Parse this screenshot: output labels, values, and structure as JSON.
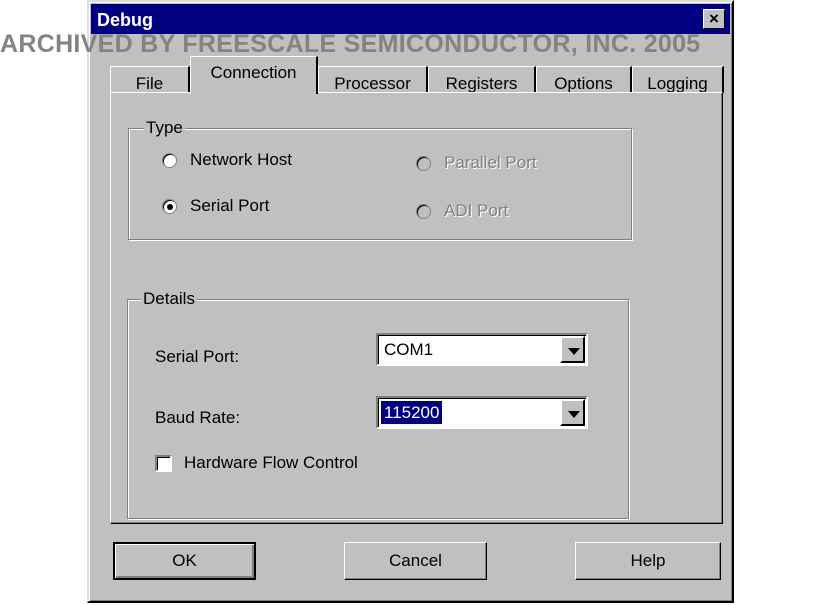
{
  "watermark": "ARCHIVED BY FREESCALE SEMICONDUCTOR, INC. 2005",
  "window": {
    "title": "Debug",
    "close_glyph": "×"
  },
  "tabs": [
    {
      "label": "File",
      "active": false
    },
    {
      "label": "Connection",
      "active": true
    },
    {
      "label": "Processor",
      "active": false
    },
    {
      "label": "Registers",
      "active": false
    },
    {
      "label": "Options",
      "active": false
    },
    {
      "label": "Logging",
      "active": false
    }
  ],
  "type_group": {
    "legend": "Type",
    "options": [
      {
        "label": "Network Host",
        "checked": false,
        "enabled": true
      },
      {
        "label": "Parallel Port",
        "checked": false,
        "enabled": false
      },
      {
        "label": "Serial Port",
        "checked": true,
        "enabled": true
      },
      {
        "label": "ADI Port",
        "checked": false,
        "enabled": false
      }
    ]
  },
  "details_group": {
    "legend": "Details",
    "serial_port_label": "Serial Port:",
    "serial_port_value": "COM1",
    "baud_rate_label": "Baud Rate:",
    "baud_rate_value": "115200",
    "flow_control_label": "Hardware Flow Control",
    "flow_control_checked": false
  },
  "buttons": {
    "ok": "OK",
    "cancel": "Cancel",
    "help": "Help"
  }
}
